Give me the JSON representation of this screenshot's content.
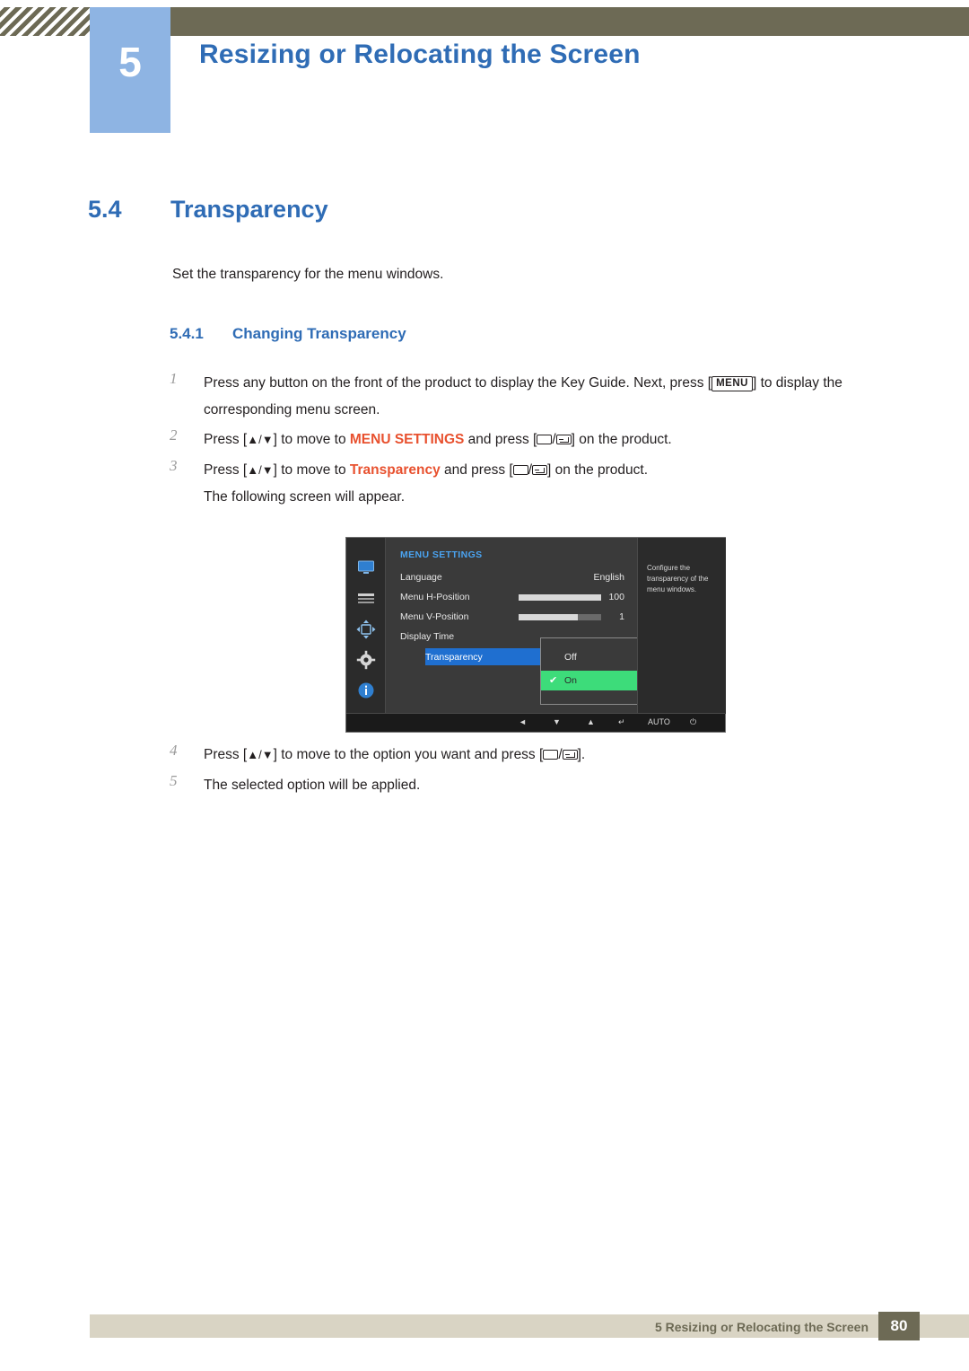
{
  "header": {
    "chapter_number": "5",
    "title": "Resizing or Relocating the Screen"
  },
  "section": {
    "number": "5.4",
    "title": "Transparency",
    "intro": "Set the transparency for the menu windows."
  },
  "subsection": {
    "number": "5.4.1",
    "title": "Changing Transparency"
  },
  "steps": [
    {
      "index": "1",
      "text_a": "Press any button on the front of the product to display the Key Guide. Next, press [",
      "key": "MENU",
      "text_b": "] to display the corresponding menu screen."
    },
    {
      "index": "2",
      "text_a": "Press [",
      "arrows": "▲/▼",
      "text_b": "] to move to ",
      "emphasis": "MENU SETTINGS",
      "emphasis_color": "#e8512f",
      "text_c": " and press [",
      "text_d": "] on the product."
    },
    {
      "index": "3",
      "text_a": "Press [",
      "arrows": "▲/▼",
      "text_b": "] to move to ",
      "emphasis": "Transparency",
      "emphasis_color": "#e8512f",
      "text_c": " and press [",
      "text_d": "] on the product.",
      "note": "The following screen will appear."
    },
    {
      "index": "4",
      "text_a": "Press [",
      "arrows": "▲/▼",
      "text_b": "] to move to the option you want and press [",
      "text_d": "]."
    },
    {
      "index": "5",
      "text_a": "The selected option will be applied."
    }
  ],
  "osd": {
    "menu_header": "MENU SETTINGS",
    "rows": [
      {
        "label": "Language",
        "value": "English",
        "bar": null
      },
      {
        "label": "Menu H-Position",
        "value": "100",
        "bar": 100
      },
      {
        "label": "Menu V-Position",
        "value": "1",
        "bar": 72
      },
      {
        "label": "Display Time",
        "value": "",
        "bar": null
      },
      {
        "label": "Transparency",
        "value": "",
        "bar": null
      }
    ],
    "popup": {
      "options": [
        {
          "label": "Off",
          "selected": false
        },
        {
          "label": "On",
          "selected": true
        }
      ],
      "check_glyph": "✔"
    },
    "description": "Configure the transparency of the menu windows.",
    "footer_buttons": [
      {
        "name": "left",
        "label": "◄"
      },
      {
        "name": "down",
        "label": "▼"
      },
      {
        "name": "up",
        "label": "▲"
      },
      {
        "name": "enter",
        "label": "↵"
      },
      {
        "name": "auto",
        "label": "AUTO"
      },
      {
        "name": "power",
        "label": "⏻"
      }
    ]
  },
  "footer": {
    "text": "5 Resizing or Relocating the Screen",
    "page": "80"
  }
}
